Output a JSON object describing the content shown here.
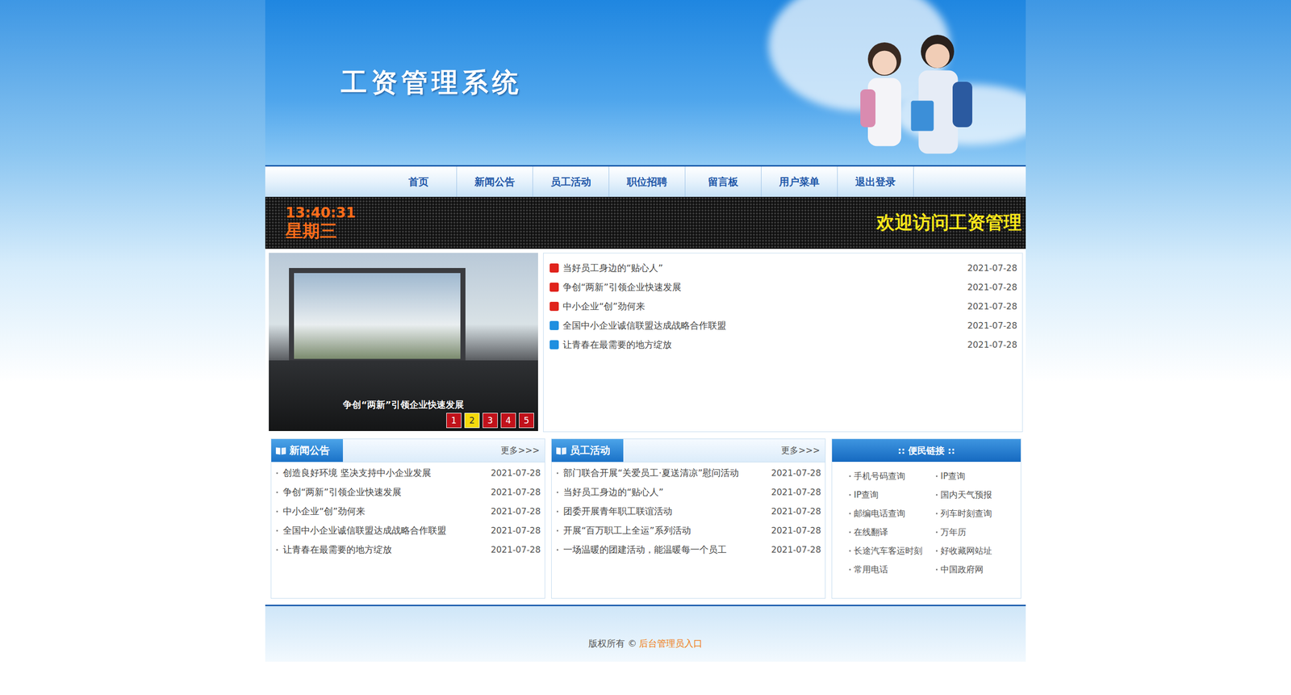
{
  "site": {
    "title": "工资管理系统"
  },
  "nav": [
    {
      "label": "首页",
      "selected": false
    },
    {
      "label": "新闻公告",
      "selected": false
    },
    {
      "label": "员工活动",
      "selected": false
    },
    {
      "label": "职位招聘",
      "selected": false
    },
    {
      "label": "留言板",
      "selected": false
    },
    {
      "label": "用户菜单",
      "selected": false
    },
    {
      "label": "退出登录",
      "selected": false
    }
  ],
  "ticker": {
    "time": "13:40:31",
    "weekday": "星期三",
    "marquee": "欢迎访问工资管理"
  },
  "slideshow": {
    "caption": "争创“两新”引领企业快速发展",
    "slides": [
      {
        "label": "1",
        "selected": false
      },
      {
        "label": "2",
        "selected": true
      },
      {
        "label": "3",
        "selected": false
      },
      {
        "label": "4",
        "selected": false
      },
      {
        "label": "5",
        "selected": false
      }
    ]
  },
  "top_news": [
    {
      "title": "当好员工身边的“贴心人”",
      "date": "2021-07-28",
      "color": "#e0231c"
    },
    {
      "title": "争创“两新”引领企业快速发展",
      "date": "2021-07-28",
      "color": "#e0231c"
    },
    {
      "title": "中小企业“创”劲何来",
      "date": "2021-07-28",
      "color": "#e0231c"
    },
    {
      "title": "全国中小企业诚信联盟达成战略合作联盟",
      "date": "2021-07-28",
      "color": "#1f8fe0"
    },
    {
      "title": "让青春在最需要的地方绽放",
      "date": "2021-07-28",
      "color": "#1f8fe0"
    }
  ],
  "panels": [
    {
      "title": "新闻公告",
      "more": "更多>>>",
      "items": [
        {
          "title": "创造良好环境 坚决支持中小企业发展",
          "date": "2021-07-28"
        },
        {
          "title": "争创“两新”引领企业快速发展",
          "date": "2021-07-28"
        },
        {
          "title": "中小企业“创”劲何来",
          "date": "2021-07-28"
        },
        {
          "title": "全国中小企业诚信联盟达成战略合作联盟",
          "date": "2021-07-28"
        },
        {
          "title": "让青春在最需要的地方绽放",
          "date": "2021-07-28"
        }
      ]
    },
    {
      "title": "员工活动",
      "more": "更多>>>",
      "items": [
        {
          "title": "部门联合开展“关爱员工·夏送清凉”慰问活动",
          "date": "2021-07-28"
        },
        {
          "title": "当好员工身边的“贴心人”",
          "date": "2021-07-28"
        },
        {
          "title": "团委开展青年职工联谊活动",
          "date": "2021-07-28"
        },
        {
          "title": "开展“百万职工上全运”系列活动",
          "date": "2021-07-28"
        },
        {
          "title": "一场温暖的团建活动，能温暖每一个员工",
          "date": "2021-07-28"
        }
      ]
    }
  ],
  "links": {
    "title": ":: 便民链接 ::",
    "items": [
      "手机号码查询",
      "IP查询",
      "IP查询",
      "国内天气预报",
      "邮编电话查询",
      "列车时刻查询",
      "在线翻译",
      "万年历",
      "长途汽车客运时刻",
      "好收藏网站址",
      "常用电话",
      "中国政府网"
    ]
  },
  "footer": {
    "text": "版权所有 ©",
    "link": "后台管理员入口"
  }
}
